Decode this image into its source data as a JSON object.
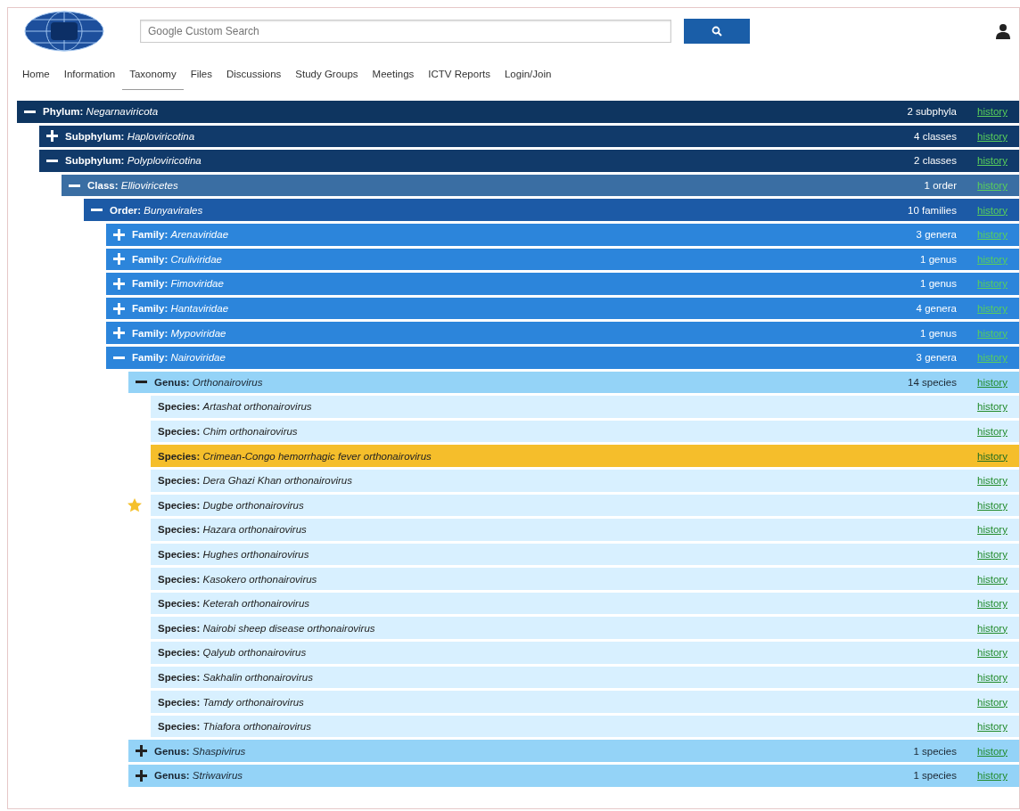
{
  "header": {
    "search": {
      "placeholder": "Google Custom Search"
    }
  },
  "nav": [
    {
      "label": "Home",
      "selected": false
    },
    {
      "label": "Information",
      "selected": false
    },
    {
      "label": "Taxonomy",
      "selected": true
    },
    {
      "label": "Files",
      "selected": false
    },
    {
      "label": "Discussions",
      "selected": false
    },
    {
      "label": "Study Groups",
      "selected": false
    },
    {
      "label": "Meetings",
      "selected": false
    },
    {
      "label": "ICTV Reports",
      "selected": false
    },
    {
      "label": "Login/Join",
      "selected": false
    }
  ],
  "tree": [
    {
      "kind": "phylum",
      "rank": "Phylum:",
      "name": "Negarnaviricota",
      "count": "2 subphyla",
      "history": "history",
      "expanded": true,
      "children": [
        {
          "kind": "subphylum",
          "rank": "Subphylum:",
          "name": "Haploviricotina",
          "count": "4 classes",
          "history": "history",
          "expanded": false
        },
        {
          "kind": "subphylum",
          "rank": "Subphylum:",
          "name": "Polyploviricotina",
          "count": "2 classes",
          "history": "history",
          "expanded": true,
          "children": [
            {
              "kind": "class",
              "rank": "Class:",
              "name": "Ellioviricetes",
              "count": "1 order",
              "history": "history",
              "expanded": true,
              "children": [
                {
                  "kind": "order",
                  "rank": "Order:",
                  "name": "Bunyavirales",
                  "count": "10 families",
                  "history": "history",
                  "expanded": true,
                  "children": [
                    {
                      "kind": "family",
                      "rank": "Family:",
                      "name": "Arenaviridae",
                      "count": "3 genera",
                      "history": "history",
                      "expanded": false
                    },
                    {
                      "kind": "family",
                      "rank": "Family:",
                      "name": "Cruliviridae",
                      "count": "1 genus",
                      "history": "history",
                      "expanded": false
                    },
                    {
                      "kind": "family",
                      "rank": "Family:",
                      "name": "Fimoviridae",
                      "count": "1 genus",
                      "history": "history",
                      "expanded": false
                    },
                    {
                      "kind": "family",
                      "rank": "Family:",
                      "name": "Hantaviridae",
                      "count": "4 genera",
                      "history": "history",
                      "expanded": false
                    },
                    {
                      "kind": "family",
                      "rank": "Family:",
                      "name": "Mypoviridae",
                      "count": "1 genus",
                      "history": "history",
                      "expanded": false
                    },
                    {
                      "kind": "family",
                      "rank": "Family:",
                      "name": "Nairoviridae",
                      "count": "3 genera",
                      "history": "history",
                      "expanded": true,
                      "children": [
                        {
                          "kind": "genus",
                          "rank": "Genus:",
                          "name": "Orthonairovirus",
                          "count": "14 species",
                          "history": "history",
                          "expanded": true,
                          "children": [
                            {
                              "kind": "species",
                              "rank": "Species:",
                              "name": "Artashat orthonairovirus",
                              "history": "history",
                              "selected": false,
                              "starred": false
                            },
                            {
                              "kind": "species",
                              "rank": "Species:",
                              "name": "Chim orthonairovirus",
                              "history": "history",
                              "selected": false,
                              "starred": false
                            },
                            {
                              "kind": "species",
                              "rank": "Species:",
                              "name": "Crimean-Congo hemorrhagic fever orthonairovirus",
                              "history": "history",
                              "selected": true,
                              "starred": false
                            },
                            {
                              "kind": "species",
                              "rank": "Species:",
                              "name": "Dera Ghazi Khan orthonairovirus",
                              "history": "history",
                              "selected": false,
                              "starred": false
                            },
                            {
                              "kind": "species",
                              "rank": "Species:",
                              "name": "Dugbe orthonairovirus",
                              "history": "history",
                              "selected": false,
                              "starred": true
                            },
                            {
                              "kind": "species",
                              "rank": "Species:",
                              "name": "Hazara orthonairovirus",
                              "history": "history",
                              "selected": false,
                              "starred": false
                            },
                            {
                              "kind": "species",
                              "rank": "Species:",
                              "name": "Hughes orthonairovirus",
                              "history": "history",
                              "selected": false,
                              "starred": false
                            },
                            {
                              "kind": "species",
                              "rank": "Species:",
                              "name": "Kasokero orthonairovirus",
                              "history": "history",
                              "selected": false,
                              "starred": false
                            },
                            {
                              "kind": "species",
                              "rank": "Species:",
                              "name": "Keterah orthonairovirus",
                              "history": "history",
                              "selected": false,
                              "starred": false
                            },
                            {
                              "kind": "species",
                              "rank": "Species:",
                              "name": "Nairobi sheep disease orthonairovirus",
                              "history": "history",
                              "selected": false,
                              "starred": false
                            },
                            {
                              "kind": "species",
                              "rank": "Species:",
                              "name": "Qalyub orthonairovirus",
                              "history": "history",
                              "selected": false,
                              "starred": false
                            },
                            {
                              "kind": "species",
                              "rank": "Species:",
                              "name": "Sakhalin orthonairovirus",
                              "history": "history",
                              "selected": false,
                              "starred": false
                            },
                            {
                              "kind": "species",
                              "rank": "Species:",
                              "name": "Tamdy orthonairovirus",
                              "history": "history",
                              "selected": false,
                              "starred": false
                            },
                            {
                              "kind": "species",
                              "rank": "Species:",
                              "name": "Thiafora orthonairovirus",
                              "history": "history",
                              "selected": false,
                              "starred": false
                            }
                          ]
                        },
                        {
                          "kind": "genus",
                          "rank": "Genus:",
                          "name": "Shaspivirus",
                          "count": "1 species",
                          "history": "history",
                          "expanded": false
                        },
                        {
                          "kind": "genus",
                          "rank": "Genus:",
                          "name": "Striwavirus",
                          "count": "1 species",
                          "history": "history",
                          "expanded": false
                        }
                      ]
                    }
                  ]
                }
              ]
            }
          ]
        }
      ]
    }
  ]
}
